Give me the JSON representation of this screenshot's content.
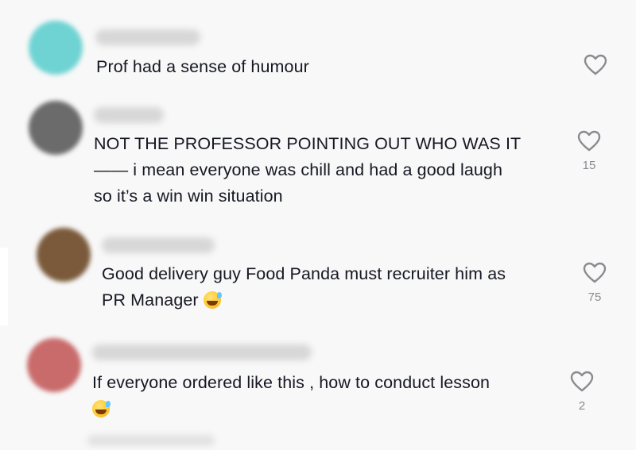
{
  "comments": [
    {
      "text": "Prof had a sense of humour",
      "likes": "",
      "avatar_color": "#6fd3d3"
    },
    {
      "text": "NOT THE PROFESSOR POINTING OUT WHO WAS IT\n—— i mean everyone was chill and had a good laugh\nso it’s a win win situation",
      "likes": "15",
      "avatar_color": "#6b6b6b"
    },
    {
      "text": "Good delivery guy Food Panda must recruiter him as\nPR Manager",
      "likes": "75",
      "avatar_color": "#7a5a3a"
    },
    {
      "text": "If everyone ordered like this , how to conduct lesson",
      "likes": "2",
      "avatar_color": "#c96b6b"
    }
  ],
  "icons": {
    "like": "heart-outline-icon",
    "emoji": "grinning-face-with-sweat-emoji"
  },
  "colors": {
    "background": "#f8f8f8",
    "text": "#161823",
    "muted": "#8a8b91"
  }
}
